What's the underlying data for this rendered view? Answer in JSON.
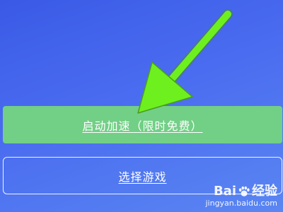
{
  "buttons": {
    "primary_label": "启动加速（限时免费）",
    "secondary_label": "选择游戏"
  },
  "watermark": {
    "brand_left": "Bai",
    "brand_right": "经验",
    "url": "jingyan.baidu.com"
  },
  "colors": {
    "background": "#4a6cf0",
    "primary_button": "#72cf86",
    "arrow": "#6ef01e"
  },
  "icons": {
    "annotation": "arrow-icon",
    "paw": "paw-icon"
  }
}
